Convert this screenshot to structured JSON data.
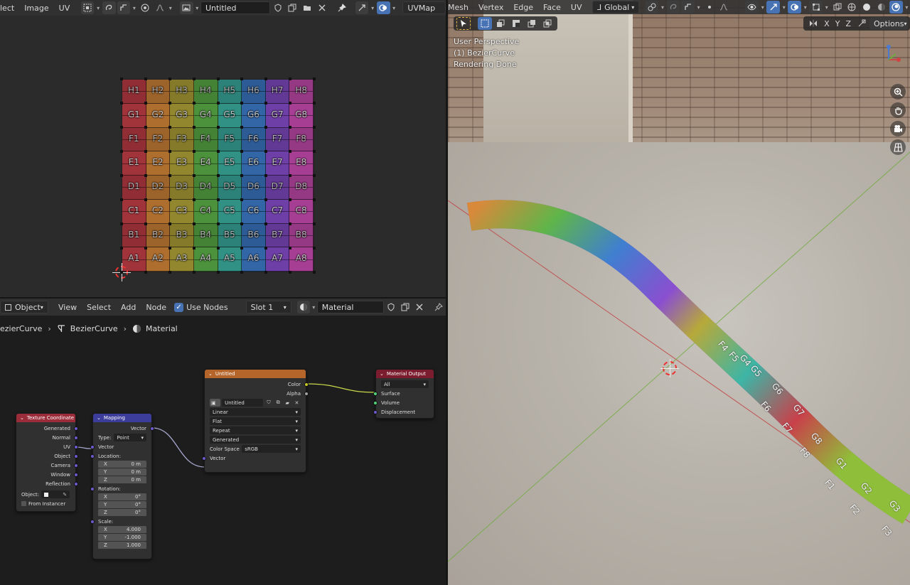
{
  "uv_editor": {
    "menus": [
      "lect",
      "Image",
      "UV"
    ],
    "image_name": "Untitled",
    "uv_map": "UVMap",
    "grid_rows": [
      [
        "H1",
        "H2",
        "H3",
        "H4",
        "H5",
        "H6",
        "H7",
        "H8"
      ],
      [
        "G1",
        "G2",
        "G3",
        "G4",
        "G5",
        "G6",
        "G7",
        "G8"
      ],
      [
        "F1",
        "F2",
        "F3",
        "F4",
        "F5",
        "F6",
        "F7",
        "F8"
      ],
      [
        "E1",
        "E2",
        "E3",
        "E4",
        "E5",
        "E6",
        "E7",
        "E8"
      ],
      [
        "D1",
        "D2",
        "D3",
        "D4",
        "D5",
        "D6",
        "D7",
        "D8"
      ],
      [
        "C1",
        "C2",
        "C3",
        "C4",
        "C5",
        "C6",
        "C7",
        "C8"
      ],
      [
        "B1",
        "B2",
        "B3",
        "B4",
        "B5",
        "B6",
        "B7",
        "B8"
      ],
      [
        "A1",
        "A2",
        "A3",
        "A4",
        "A5",
        "A6",
        "A7",
        "A8"
      ]
    ],
    "column_colors": [
      "#c9404a",
      "#d9893a",
      "#b7a93a",
      "#5fb54a",
      "#3db5a6",
      "#3f7fd0",
      "#8a4fd0",
      "#cf4fb8"
    ]
  },
  "node_editor": {
    "mode": "Object",
    "menus": [
      "View",
      "Select",
      "Add",
      "Node"
    ],
    "use_nodes_label": "Use Nodes",
    "slot": "Slot 1",
    "material": "Material",
    "breadcrumb": [
      "ezierCurve",
      "BezierCurve",
      "Material"
    ],
    "texture_coordinate": {
      "title": "Texture Coordinate",
      "outputs": [
        "Generated",
        "Normal",
        "UV",
        "Object",
        "Camera",
        "Window",
        "Reflection"
      ],
      "object_label": "Object:",
      "from_instancer": "From Instancer"
    },
    "mapping": {
      "title": "Mapping",
      "output": "Vector",
      "type_label": "Type:",
      "type_value": "Point",
      "vector_input": "Vector",
      "location_label": "Location:",
      "location": [
        {
          "axis": "X",
          "value": "0 m"
        },
        {
          "axis": "Y",
          "value": "0 m"
        },
        {
          "axis": "Z",
          "value": "0 m"
        }
      ],
      "rotation_label": "Rotation:",
      "rotation": [
        {
          "axis": "X",
          "value": "0°"
        },
        {
          "axis": "Y",
          "value": "0°"
        },
        {
          "axis": "Z",
          "value": "0°"
        }
      ],
      "scale_label": "Scale:",
      "scale": [
        {
          "axis": "X",
          "value": "4.000"
        },
        {
          "axis": "Y",
          "value": "-1.000"
        },
        {
          "axis": "Z",
          "value": "1.000"
        }
      ]
    },
    "image_texture": {
      "title": "Untitled",
      "outputs": [
        "Color",
        "Alpha"
      ],
      "image": "Untitled",
      "interpolation": "Linear",
      "projection": "Flat",
      "extension": "Repeat",
      "source": "Generated",
      "color_space_label": "Color Space",
      "color_space": "sRGB",
      "vector_input": "Vector"
    },
    "material_output": {
      "title": "Material Output",
      "target": "All",
      "inputs": [
        "Surface",
        "Volume",
        "Displacement"
      ]
    }
  },
  "viewport": {
    "menus": [
      "Mesh",
      "Vertex",
      "Edge",
      "Face",
      "UV"
    ],
    "orientation": "Global",
    "axes": [
      "X",
      "Y",
      "Z"
    ],
    "options_label": "Options",
    "info": [
      "User Perspective",
      "(1) BezierCurve",
      "Rendering Done"
    ],
    "tube_labels": [
      "G5",
      "G6",
      "F6",
      "G7",
      "F7",
      "G8",
      "F8",
      "G1",
      "F1",
      "G2",
      "F2",
      "G3",
      "F3",
      "F4",
      "F5",
      "G4"
    ]
  }
}
